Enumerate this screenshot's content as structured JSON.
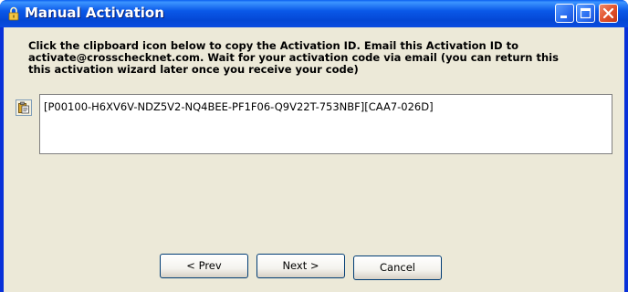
{
  "window": {
    "title": "Manual Activation",
    "title_icon": "lock-icon",
    "controls": {
      "minimize_icon": "minimize-icon",
      "maximize_icon": "maximize-icon",
      "close_icon": "close-icon"
    }
  },
  "instructions": {
    "line1": "Click the clipboard icon below to copy the Activation ID.  Email this Activation ID to",
    "line2": "activate@crosschecknet.com.  Wait for your activation code via email (you can return this",
    "line3": "this activation wizard later once you receive your code)"
  },
  "clipboard": {
    "icon": "clipboard-icon"
  },
  "activation_id": {
    "value": "[P00100-H6XV6V-NDZ5V2-NQ4BEE-PF1F06-Q9V22T-753NBF][CAA7-026D]"
  },
  "buttons": {
    "prev": "< Prev",
    "next": "Next >",
    "cancel": "Cancel"
  },
  "colors": {
    "titlebar": "#0a58e8",
    "client_bg": "#ece9d8",
    "close_button": "#e0502a"
  }
}
